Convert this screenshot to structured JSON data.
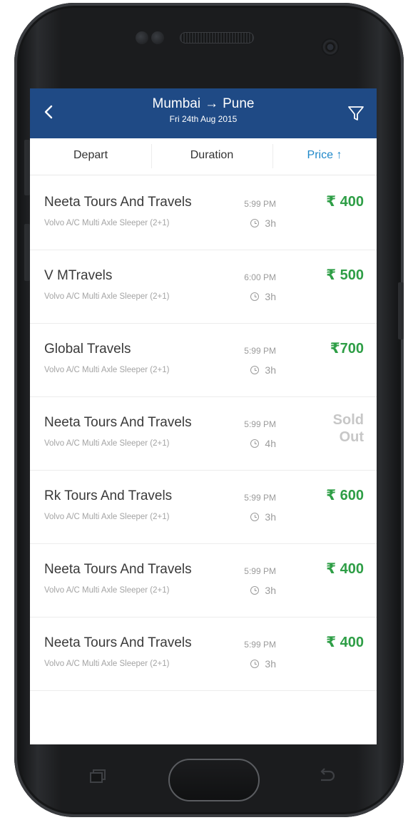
{
  "header": {
    "from": "Mumbai",
    "arrow": "→",
    "to": "Pune",
    "date": "Fri 24th Aug 2015"
  },
  "icons": {
    "back": "chevron-left-icon",
    "filter": "filter-funnel-icon",
    "clock": "clock-icon",
    "nav_recent": "recent-apps-icon",
    "nav_back": "back-arrow-icon"
  },
  "sort": {
    "depart": "Depart",
    "duration": "Duration",
    "price": "Price ↑"
  },
  "colors": {
    "header_bg": "#1f4a85",
    "active_sort": "#1f88c9",
    "price_green": "#2e9e46",
    "sold_out_grey": "#c7c7c7"
  },
  "buses": [
    {
      "name": "Neeta Tours And Travels",
      "type": "Volvo A/C Multi Axle Sleeper (2+1)",
      "departure": "5:99 PM",
      "duration": "3h",
      "price": "₹ 400"
    },
    {
      "name": "V MTravels",
      "type": "Volvo A/C Multi Axle Sleeper (2+1)",
      "departure": "6:00 PM",
      "duration": "3h",
      "price": "₹ 500"
    },
    {
      "name": "Global Travels",
      "type": "Volvo A/C Multi Axle Sleeper (2+1)",
      "departure": "5:99 PM",
      "duration": "3h",
      "price": "₹700"
    },
    {
      "name": "Neeta Tours And Travels",
      "type": "Volvo A/C Multi Axle Sleeper (2+1)",
      "departure": "5:99 PM",
      "duration": "4h",
      "price": "Sold Out",
      "sold_out": true
    },
    {
      "name": "Rk Tours And Travels",
      "type": "Volvo A/C Multi Axle Sleeper (2+1)",
      "departure": "5:99 PM",
      "duration": "3h",
      "price": "₹ 600"
    },
    {
      "name": "Neeta Tours And Travels",
      "type": "Volvo A/C Multi Axle Sleeper (2+1)",
      "departure": "5:99 PM",
      "duration": "3h",
      "price": "₹ 400"
    },
    {
      "name": "Neeta Tours And Travels",
      "type": "Volvo A/C Multi Axle Sleeper (2+1)",
      "departure": "5:99 PM",
      "duration": "3h",
      "price": "₹ 400"
    }
  ]
}
